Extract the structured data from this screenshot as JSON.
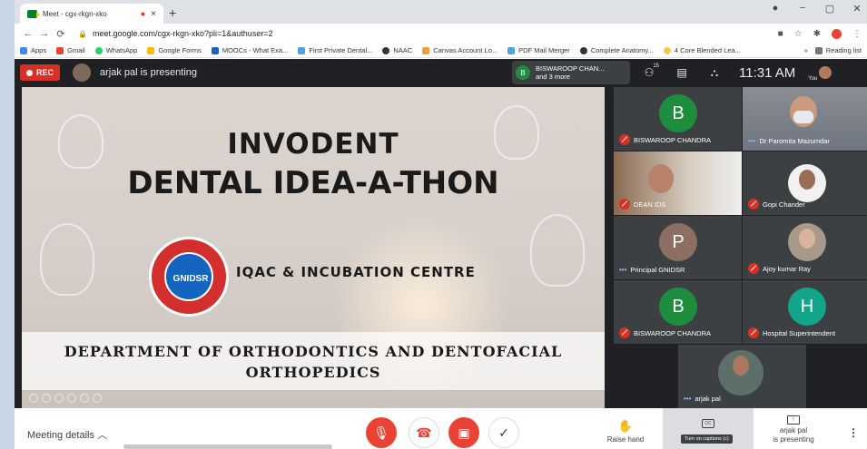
{
  "browser": {
    "tab_title": "Meet - cgx-rkgn-xko",
    "tab_rec_indicator": "●",
    "tab_close": "×",
    "new_tab": "+",
    "window_controls": [
      "●",
      "−",
      "▢",
      "✕"
    ],
    "url": "meet.google.com/cgx-rkgn-xko?pli=1&authuser=2",
    "bookmarks": [
      {
        "label": "Apps",
        "color": "#4285f4"
      },
      {
        "label": "Gmail",
        "color": "#ea4335"
      },
      {
        "label": "WhatsApp",
        "color": "#25d366"
      },
      {
        "label": "Google Forms",
        "color": "#fbbc04"
      },
      {
        "label": "MOOCs - What Exa...",
        "color": "#1565c0"
      },
      {
        "label": "First Private Dental...",
        "color": "#4aa3df"
      },
      {
        "label": "NAAC",
        "color": "#333333"
      },
      {
        "label": "Canvas Account Lo...",
        "color": "#e8a23a"
      },
      {
        "label": "PDF Mail Merger",
        "color": "#4aa3df"
      },
      {
        "label": "Complete Anatomy...",
        "color": "#333333"
      },
      {
        "label": "4 Core Blended Lea...",
        "color": "#f2c94c"
      }
    ],
    "bookmarks_more": "»",
    "reading_list": "Reading list"
  },
  "meet": {
    "rec_label": "REC",
    "presenting_text": "arjak pal is presenting",
    "active_speaker": {
      "initial": "B",
      "name": "BISWAROOP CHAN...",
      "more": "and 3 more"
    },
    "people_count": "15",
    "clock": "11:31 AM",
    "you_label": "You"
  },
  "slide": {
    "title_line1": "INVODENT",
    "title_line2": "DENTAL IDEA-A-THON",
    "logo_text": "GNIDSR",
    "centre": "IQAC & INCUBATION CENTRE",
    "dept_line1": "DEPARTMENT OF ORTHODONTICS AND DENTOFACIAL",
    "dept_line2": "ORTHOPEDICS"
  },
  "participants": [
    {
      "name": "BISWAROOP CHANDRA",
      "initial": "B",
      "avatar_color": "#1e8e3e",
      "status": "muted"
    },
    {
      "name": "Dr Paromita Mazumdar",
      "initial": "",
      "avatar_color": "",
      "status": "speaking"
    },
    {
      "name": "DEAN IDS",
      "initial": "",
      "avatar_color": "",
      "status": "muted"
    },
    {
      "name": "Gopi Chander",
      "initial": "",
      "avatar_color": "",
      "status": "muted"
    },
    {
      "name": "Principal GNIDSR",
      "initial": "P",
      "avatar_color": "#8d6e63",
      "status": "speaking"
    },
    {
      "name": "Ajoy kumar Ray",
      "initial": "",
      "avatar_color": "",
      "status": "muted"
    },
    {
      "name": "BISWAROOP CHANDRA",
      "initial": "B",
      "avatar_color": "#1e8e3e",
      "status": "muted"
    },
    {
      "name": "Hospital Superintendent",
      "initial": "H",
      "avatar_color": "#12a589",
      "status": "muted"
    },
    {
      "name": "arjak pal",
      "initial": "",
      "avatar_color": "",
      "status": "speaking"
    }
  ],
  "bottom": {
    "meeting_details": "Meeting details",
    "raise_hand": "Raise hand",
    "captions_tooltip": "Turn on captions (c)",
    "captions_icon": "CC",
    "presenter_line1": "arjak pal",
    "presenter_line2": "is presenting"
  }
}
